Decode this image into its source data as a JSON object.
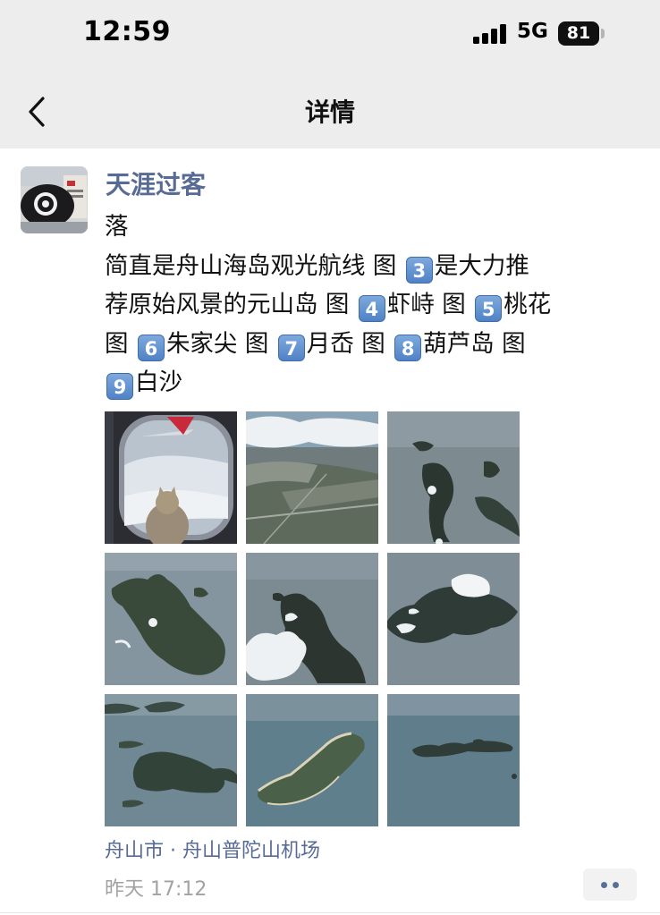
{
  "status_bar": {
    "time": "12:59",
    "network": "5G",
    "battery": "81",
    "icons": [
      "signal-bars-icon",
      "battery-icon"
    ]
  },
  "nav": {
    "title": "详情",
    "back_icon": "chevron-left-icon"
  },
  "post": {
    "author": "天涯过客",
    "lines": [
      {
        "segments": [
          {
            "t": "落"
          }
        ]
      },
      {
        "segments": [
          {
            "t": "简直是舟山海岛观光航线 图 "
          },
          {
            "n": "3"
          },
          {
            "t": "是大力推"
          }
        ]
      },
      {
        "segments": [
          {
            "t": "荐原始风景的元山岛 图 "
          },
          {
            "n": "4"
          },
          {
            "t": "虾峙 图 "
          },
          {
            "n": "5"
          },
          {
            "t": "桃花"
          }
        ]
      },
      {
        "segments": [
          {
            "t": " 图 "
          },
          {
            "n": "6"
          },
          {
            "t": "朱家尖 图 "
          },
          {
            "n": "7"
          },
          {
            "t": "月岙 图 "
          },
          {
            "n": "8"
          },
          {
            "t": "葫芦岛 图"
          }
        ]
      },
      {
        "segments": [
          {
            "n": "9"
          },
          {
            "t": "白沙"
          }
        ]
      }
    ],
    "photos": [
      "airplane-window-cat-photo",
      "aerial-city-clouds-photo",
      "aerial-islands-photo",
      "aerial-island-photo",
      "aerial-island-cloud-photo",
      "aerial-island-cloud-photo",
      "aerial-islands-photo",
      "aerial-island-coast-photo",
      "aerial-islands-sea-photo"
    ],
    "location": "舟山市 · 舟山普陀山机场",
    "time": "昨天 17:12",
    "more_icon": "more-dots-icon"
  },
  "colors": {
    "link_blue": "#576b95",
    "header_bg": "#ededed",
    "number_badge": "#5b8dd0",
    "meta_gray": "#a2a2a2"
  }
}
